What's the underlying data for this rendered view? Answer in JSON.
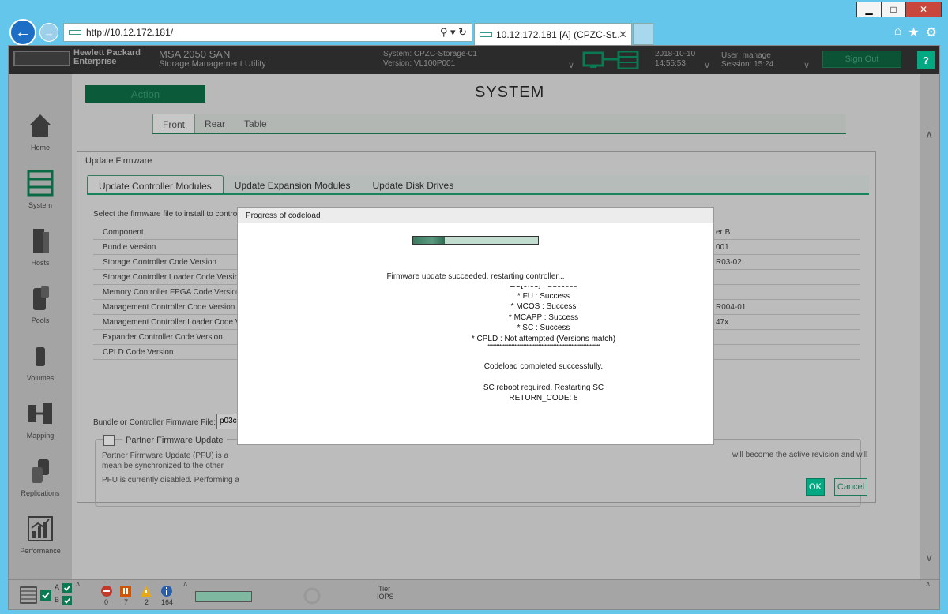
{
  "browser": {
    "url": "http://10.12.172.181/",
    "tab_title": "10.12.172.181 [A] (CPZC-St...",
    "win_minimize": "▁",
    "win_maximize": "□",
    "win_close": "✕",
    "addr_tools": "⚲ ▾ ↻",
    "tab_close": "✕"
  },
  "header": {
    "brand": "Hewlett Packard Enterprise",
    "product_name": "MSA 2050 SAN",
    "product_sub": "Storage Management Utility",
    "system": "System: CPZC-Storage-01",
    "version": "Version: VL100P001",
    "date": "2018-10-10",
    "time": "14:55:53",
    "user": "User: manage",
    "session": "Session: 15:24",
    "sign_out": "Sign Out",
    "help": "?"
  },
  "sidebar": {
    "items": [
      {
        "label": "Home",
        "icon": "home-icon"
      },
      {
        "label": "System",
        "icon": "system-icon"
      },
      {
        "label": "Hosts",
        "icon": "hosts-icon"
      },
      {
        "label": "Pools",
        "icon": "pools-icon"
      },
      {
        "label": "Volumes",
        "icon": "volumes-icon"
      },
      {
        "label": "Mapping",
        "icon": "mapping-icon"
      },
      {
        "label": "Replications",
        "icon": "replications-icon"
      },
      {
        "label": "Performance",
        "icon": "performance-icon"
      }
    ]
  },
  "main": {
    "action": "Action",
    "title": "SYSTEM",
    "tabs": [
      "Front",
      "Rear",
      "Table"
    ]
  },
  "update_firmware": {
    "title": "Update Firmware",
    "tabs": [
      "Update Controller Modules",
      "Update Expansion Modules",
      "Update Disk Drives"
    ],
    "description": "Select the firmware file to install to controlle",
    "rows": [
      {
        "label": "Component",
        "right": "er B"
      },
      {
        "label": "Bundle Version",
        "right": "001"
      },
      {
        "label": "Storage Controller Code Version",
        "right": "R03-02"
      },
      {
        "label": "Storage Controller Loader Code Version",
        "right": ""
      },
      {
        "label": "Memory Controller FPGA Code Version",
        "right": ""
      },
      {
        "label": "Management Controller Code Version",
        "right": "R004-01"
      },
      {
        "label": "Management Controller Loader Code Ver",
        "right": "47x"
      },
      {
        "label": "Expander Controller Code Version",
        "right": ""
      },
      {
        "label": "CPLD Code Version",
        "right": ""
      }
    ],
    "file_label": "Bundle or Controller Firmware File:",
    "file_value": "p03c0",
    "pfu_label": "Partner Firmware Update",
    "pfu_text1": "Partner Firmware Update (PFU) is a mean be synchronized to the other controller. If",
    "pfu_text1_right": "will become the active revision and will",
    "pfu_text2": "PFU is currently disabled. Performing a fi",
    "ok": "OK",
    "cancel": "Cancel"
  },
  "progress": {
    "title": "Progress of codeload",
    "progress_fraction": 0.25,
    "status": "Firmware update succeeded, restarting controller...",
    "log_lines": [
      "EC[0:03] : Success",
      "* FU : Success",
      "* MCOS : Success",
      "* MCAPP : Success",
      "* SC : Success",
      "* CPLD : Not attempted (Versions match)",
      "*******************************************************************",
      "",
      "Codeload completed successfully.",
      "",
      "SC reboot required. Restarting SC",
      "RETURN_CODE: 8"
    ]
  },
  "status_bar": {
    "counts": [
      "0",
      "7",
      "2",
      "164"
    ],
    "tier_label": "Tier",
    "iops_label": "IOPS",
    "controller_a": "A",
    "controller_b": "B"
  },
  "colors": {
    "accent": "#01a982",
    "dark_green": "#0b5b3a",
    "chrome_blue": "#65c6ec"
  }
}
